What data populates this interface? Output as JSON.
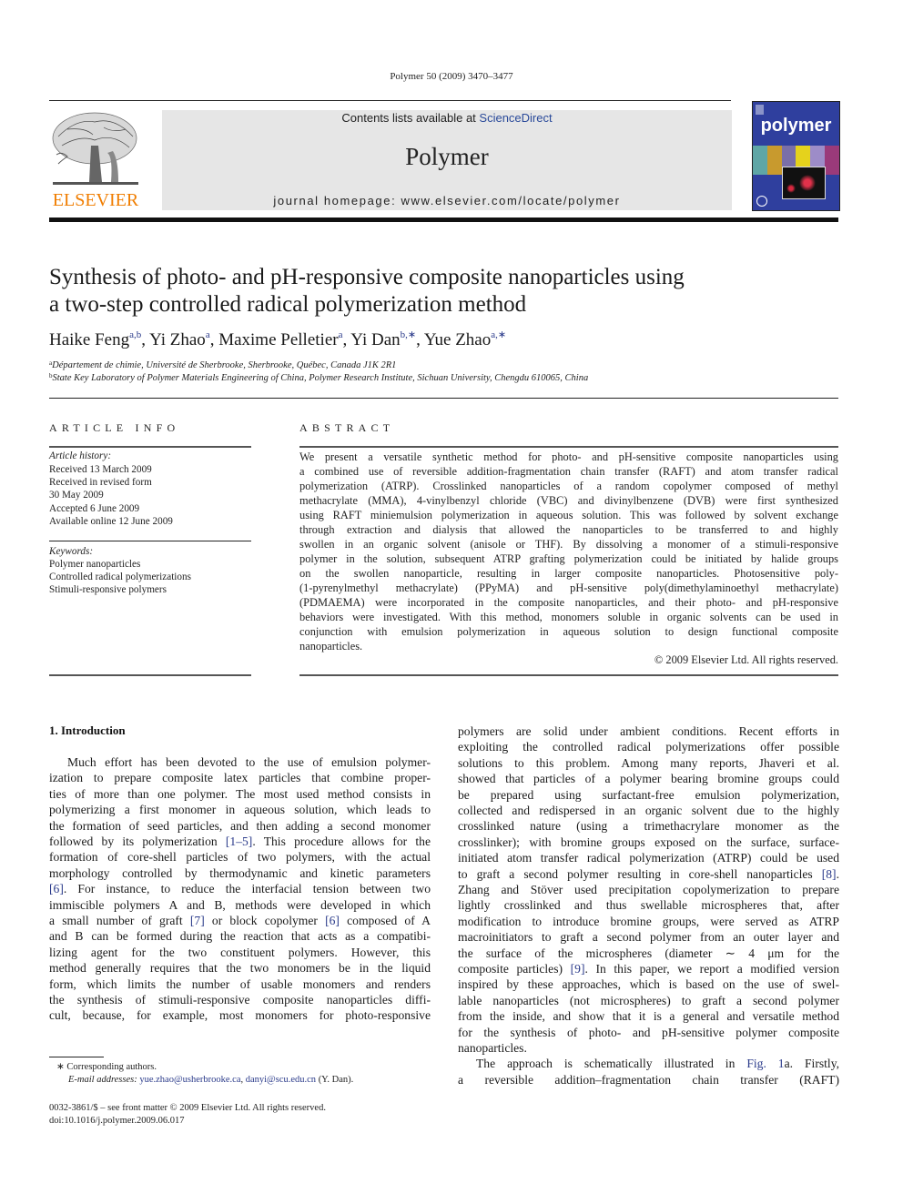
{
  "header": {
    "citation": "Polymer 50 (2009) 3470–3477",
    "contents_prefix": "Contents lists available at ",
    "contents_link": "ScienceDirect",
    "journal_name": "Polymer",
    "homepage": "journal homepage: www.elsevier.com/locate/polymer",
    "publisher_logo_text": "ELSEVIER",
    "cover_title": "polymer",
    "colors": {
      "elsevier_orange": "#f07d00",
      "link_blue": "#2a4a9a",
      "cover_blue": "#2f3f9e",
      "header_gray": "#e6e6e6"
    }
  },
  "article": {
    "title_line1": "Synthesis of photo- and pH-responsive composite nanoparticles using",
    "title_line2": "a two-step controlled radical polymerization method",
    "authors": [
      {
        "name": "Haike Feng",
        "sup": "a,b"
      },
      {
        "name": "Yi Zhao",
        "sup": "a"
      },
      {
        "name": "Maxime Pelletier",
        "sup": "a"
      },
      {
        "name": "Yi Dan",
        "sup": "b,∗"
      },
      {
        "name": "Yue Zhao",
        "sup": "a,∗"
      }
    ],
    "affiliations": [
      {
        "mark": "a",
        "text": "Département de chimie, Université de Sherbrooke, Sherbrooke, Québec, Canada J1K 2R1"
      },
      {
        "mark": "b",
        "text": "State Key Laboratory of Polymer Materials Engineering of China, Polymer Research Institute, Sichuan University, Chengdu 610065, China"
      }
    ]
  },
  "article_info": {
    "heading": "ARTICLE INFO",
    "history_label": "Article history:",
    "history": [
      "Received 13 March 2009",
      "Received in revised form",
      "30 May 2009",
      "Accepted 6 June 2009",
      "Available online 12 June 2009"
    ],
    "keywords_label": "Keywords:",
    "keywords": [
      "Polymer nanoparticles",
      "Controlled radical polymerizations",
      "Stimuli-responsive polymers"
    ]
  },
  "abstract": {
    "heading": "ABSTRACT",
    "lines": [
      "We present a versatile synthetic method for photo- and pH-sensitive composite nanoparticles using",
      "a combined use of reversible addition-fragmentation chain transfer (RAFT) and atom transfer radical",
      "polymerization (ATRP). Crosslinked nanoparticles of a random copolymer composed of methyl",
      "methacrylate (MMA), 4-vinylbenzyl chloride (VBC) and divinylbenzene (DVB) were first synthesized",
      "using RAFT miniemulsion polymerization in aqueous solution. This was followed by solvent exchange",
      "through extraction and dialysis that allowed the nanoparticles to be transferred to and highly",
      "swollen in an organic solvent (anisole or THF). By dissolving a monomer of a stimuli-responsive",
      "polymer in the solution, subsequent ATRP grafting polymerization could be initiated by halide groups",
      "on the swollen nanoparticle, resulting in larger composite nanoparticles. Photosensitive poly-",
      "(1-pyrenylmethyl methacrylate) (PPyMA) and pH-sensitive poly(dimethylaminoethyl methacrylate)",
      "(PDMAEMA) were incorporated in the composite nanoparticles, and their photo- and pH-responsive",
      "behaviors were investigated. With this method, monomers soluble in organic solvents can be used in",
      "conjunction with emulsion polymerization in aqueous solution to design functional composite",
      "nanoparticles."
    ],
    "copyright": "© 2009 Elsevier Ltd. All rights reserved."
  },
  "introduction": {
    "heading": "1.  Introduction",
    "left_lines": [
      "Much effort has been devoted to the use of emulsion polymer-",
      "ization to prepare composite latex particles that combine proper-",
      "ties of more than one polymer. The most used method consists in",
      "polymerizing a first monomer in aqueous solution, which leads to",
      "the formation of seed particles, and then adding a second monomer",
      "followed by its polymerization [1–5]. This procedure allows for the",
      "formation of core-shell particles of two polymers, with the actual",
      "morphology controlled by thermodynamic and kinetic parameters",
      "[6]. For instance, to reduce the interfacial tension between two",
      "immiscible polymers A and B, methods were developed in which",
      "a small number of graft [7] or block copolymer [6] composed of A",
      "and B can be formed during the reaction that acts as a compatibi-",
      "lizing agent for the two constituent polymers. However, this",
      "method generally requires that the two monomers be in the liquid",
      "form, which limits the number of usable monomers and renders",
      "the synthesis of stimuli-responsive composite nanoparticles diffi-",
      "cult, because, for example, most monomers for photo-responsive"
    ],
    "right_lines": [
      "polymers are solid under ambient conditions. Recent efforts in",
      "exploiting the controlled radical polymerizations offer possible",
      "solutions to this problem. Among many reports, Jhaveri et al.",
      "showed that particles of a polymer bearing bromine groups could",
      "be prepared using surfactant-free emulsion polymerization,",
      "collected and redispersed in an organic solvent due to the highly",
      "crosslinked nature (using a trimethacrylare monomer as the",
      "crosslinker); with bromine groups exposed on the surface, surface-",
      "initiated atom transfer radical polymerization (ATRP) could be used",
      "to graft a second polymer resulting in core-shell nanoparticles [8].",
      "Zhang and Stöver used precipitation copolymerization to prepare",
      "lightly crosslinked and thus swellable microspheres that, after",
      "modification to introduce bromine groups, were served as ATRP",
      "macroinitiators to graft a second polymer from an outer layer and",
      "the surface of the microspheres (diameter ∼ 4 μm for the",
      "composite particles) [9]. In this paper, we report a modified version",
      "inspired by these approaches, which is based on the use of swel-",
      "lable nanoparticles (not microspheres) to graft a second polymer",
      "from the inside, and show that it is a general and versatile method",
      "for the synthesis of photo- and pH-sensitive polymer composite",
      "nanoparticles.",
      "The approach is schematically illustrated in Fig. 1a. Firstly,",
      "a reversible addition–fragmentation chain transfer (RAFT)"
    ],
    "references_cited": [
      "[1–5]",
      "[6]",
      "[7]",
      "[6]",
      "[8]",
      "[9]",
      "Fig. 1"
    ]
  },
  "footnotes": {
    "corresponding": "∗  Corresponding authors.",
    "email_label": "E-mail addresses:",
    "email1": "yue.zhao@usherbrooke.ca",
    "email_sep": ", ",
    "email2": "danyi@scu.edu.cn",
    "email_suffix": " (Y. Dan).",
    "front_matter": "0032-3861/$ – see front matter © 2009 Elsevier Ltd. All rights reserved.",
    "doi": "doi:10.1016/j.polymer.2009.06.017"
  }
}
